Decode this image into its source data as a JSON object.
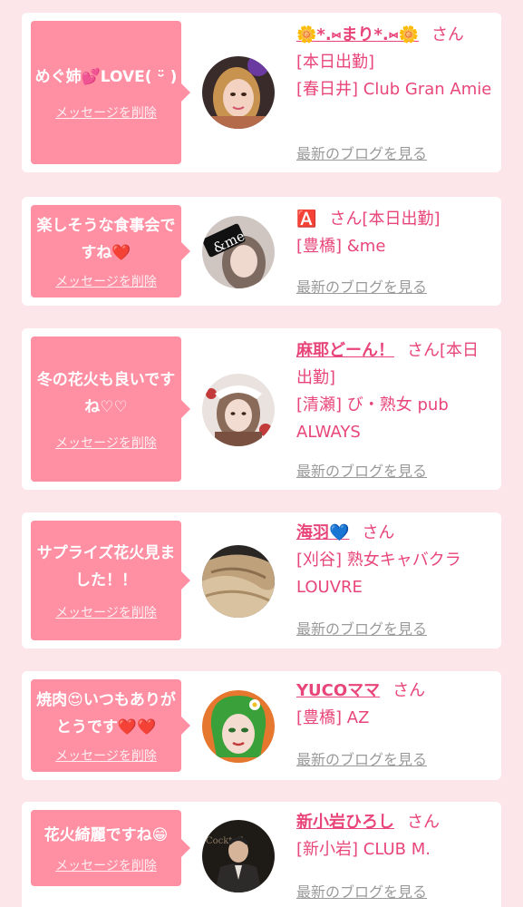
{
  "delete_label": "メッセージを削除",
  "blog_label": "最新のブログを見る",
  "san": "さん",
  "cards": [
    {
      "message": "めぐ姉💕LOVE( ᵕ̈ )",
      "name": "🌼*.⑅まり*.⑅🌼",
      "status": "[本日出勤]",
      "shop": "[春日井] Club Gran Amie",
      "avatar_icon": "woman-selfie-avatar"
    },
    {
      "message": "楽しそうな食事会ですね❤️",
      "name": "🅰️",
      "status": "[本日出勤]",
      "shop": "[豊橋] &me",
      "avatar_icon": "me-logo-avatar"
    },
    {
      "message": "冬の花火も良いですね♡♡",
      "name": "麻耶どーん！",
      "status": "[本日出勤]",
      "shop": "[清瀬] び・熟女 pub ALWAYS",
      "avatar_icon": "woman-holiday-avatar"
    },
    {
      "message": "サプライズ花火見ました！！",
      "name": "海羽💙",
      "status": "",
      "shop": "[刈谷] 熟女キャバクラ LOUVRE",
      "avatar_icon": "blonde-hair-avatar"
    },
    {
      "message": "焼肉😍いつもありがとうです❤️❤️",
      "name": "YUCOママ",
      "status": "",
      "shop": "[豊橋] AZ",
      "avatar_icon": "green-hair-illustration-avatar"
    },
    {
      "message": "花火綺麗ですね😁",
      "name": "新小岩ひろし",
      "status": "",
      "shop": "[新小岩] CLUB M.",
      "avatar_icon": "man-suit-avatar"
    }
  ],
  "colors": {
    "page_bg": "#fde6ea",
    "bubble_bg": "#ff8fa3",
    "link_pink": "#e8467a",
    "blog_gray": "#9a9a9a"
  }
}
